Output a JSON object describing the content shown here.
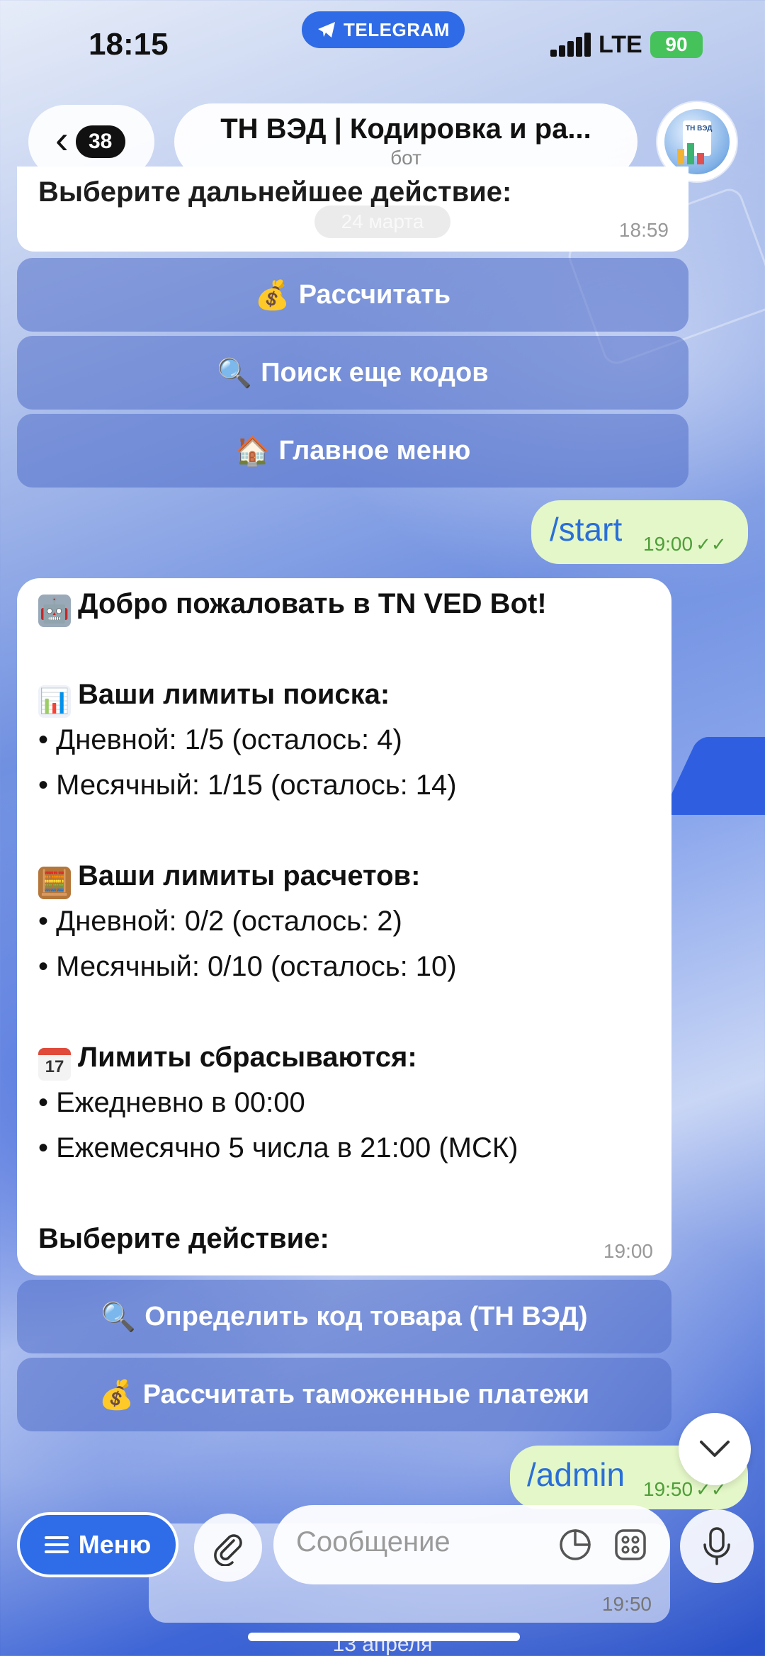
{
  "status_bar": {
    "time": "18:15",
    "app_pill": "TELEGRAM",
    "network": "LTE",
    "battery": "90"
  },
  "header": {
    "back_count": "38",
    "title": "ТН ВЭД | Кодировка и ра...",
    "subtitle": "бот"
  },
  "messages": {
    "top_partial": {
      "text": "Выберите дальнейшее действие:",
      "time": "18:59",
      "date_pill": "24 марта"
    },
    "keyboard1": [
      {
        "emoji": "💰",
        "label": "Рассчитать"
      },
      {
        "emoji": "🔍",
        "label": "Поиск еще кодов"
      },
      {
        "emoji": "🏠",
        "label": "Главное меню"
      }
    ],
    "out1": {
      "text": "/start",
      "time": "19:00"
    },
    "welcome": {
      "title": "Добро пожаловать в TN VED Bot!",
      "search_header": "Ваши лимиты поиска:",
      "search_daily": "• Дневной: 1/5 (осталось: 4)",
      "search_monthly": "• Месячный: 1/15 (осталось: 14)",
      "calc_header": "Ваши лимиты расчетов:",
      "calc_daily": "• Дневной: 0/2 (осталось: 2)",
      "calc_monthly": "• Месячный: 0/10 (осталось: 10)",
      "reset_header": "Лимиты сбрасываются:",
      "reset_daily": "• Ежедневно в 00:00",
      "reset_monthly": "• Ежемесячно 5 числа в 21:00 (МСК)",
      "choose": "Выберите действие:",
      "time": "19:00",
      "calendar_day": "17"
    },
    "keyboard2": [
      {
        "emoji": "🔍",
        "label": "Определить код товара (ТН ВЭД)"
      },
      {
        "emoji": "💰",
        "label": "Рассчитать таможенные платежи"
      }
    ],
    "out2": {
      "text": "/admin",
      "time": "19:50"
    },
    "behind": {
      "time": "19:50"
    },
    "date_bottom": "13 апреля"
  },
  "composer": {
    "menu_label": "Меню",
    "placeholder": "Сообщение"
  },
  "colors": {
    "accent": "#2e6ce8",
    "outgoing": "#e4f7c8",
    "command": "#2a6fd8"
  }
}
